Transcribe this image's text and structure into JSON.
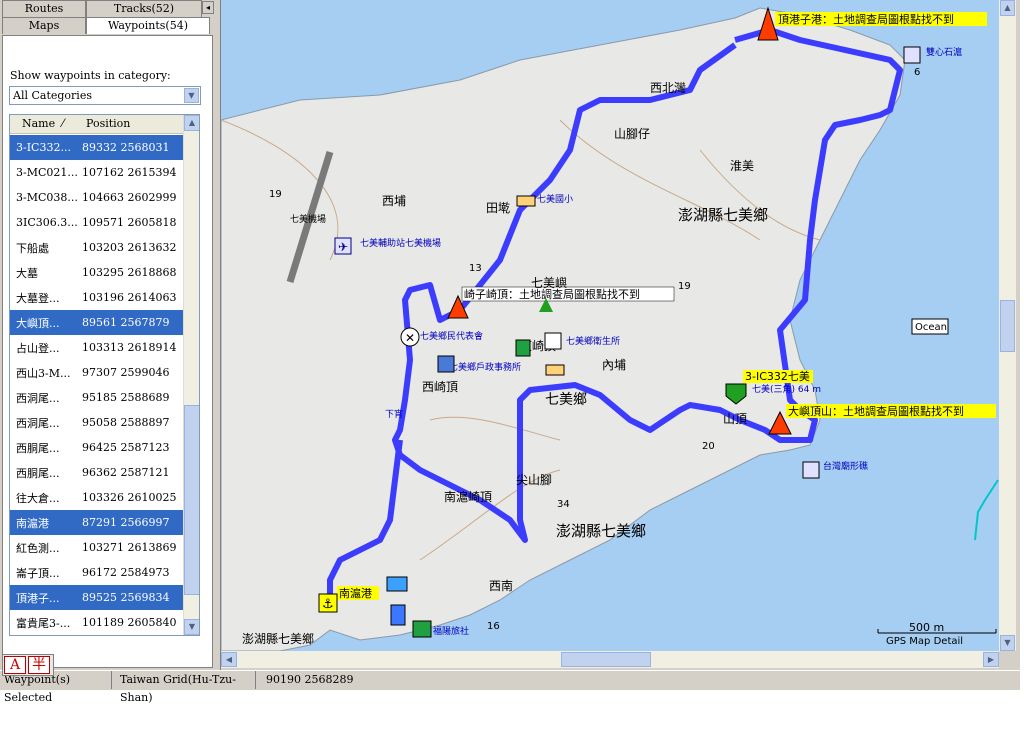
{
  "tabs": {
    "routes": "Routes",
    "tracks": "Tracks(52)",
    "maps": "Maps",
    "waypoints": "Waypoints(54)"
  },
  "collapse_glyph": "◂",
  "category": {
    "label": "Show waypoints in category:",
    "selected": "All Categories"
  },
  "list": {
    "col_name": "Name",
    "col_sort": "⁄",
    "col_position": "Position",
    "rows": [
      {
        "name": "3-IC332...",
        "position": "89332 2568031",
        "selected": true
      },
      {
        "name": "3-MC021...",
        "position": "107162 2615394",
        "selected": false
      },
      {
        "name": "3-MC038...",
        "position": "104663 2602999",
        "selected": false
      },
      {
        "name": "3IC306.3...",
        "position": "109571 2605818",
        "selected": false
      },
      {
        "name": "下船處",
        "position": "103203 2613632",
        "selected": false
      },
      {
        "name": "大墓",
        "position": "103295 2618868",
        "selected": false
      },
      {
        "name": "大墓登...",
        "position": "103196 2614063",
        "selected": false
      },
      {
        "name": "大嶼頂...",
        "position": "89561 2567879",
        "selected": true
      },
      {
        "name": "占山登...",
        "position": "103313 2618914",
        "selected": false
      },
      {
        "name": "西山3-M...",
        "position": "97307 2599046",
        "selected": false
      },
      {
        "name": "西洞尾...",
        "position": "95185 2588689",
        "selected": false
      },
      {
        "name": "西洞尾...",
        "position": "95058 2588897",
        "selected": false
      },
      {
        "name": "西胴尾...",
        "position": "96425 2587123",
        "selected": false
      },
      {
        "name": "西胴尾...",
        "position": "96362 2587121",
        "selected": false
      },
      {
        "name": "往大倉...",
        "position": "103326 2610025",
        "selected": false
      },
      {
        "name": "南滬港",
        "position": "87291 2566997",
        "selected": true
      },
      {
        "name": "紅色測...",
        "position": "103271 2613869",
        "selected": false
      },
      {
        "name": "崙子頂...",
        "position": "96172 2584973",
        "selected": false
      },
      {
        "name": "頂港子...",
        "position": "89525 2569834",
        "selected": true
      },
      {
        "name": "富貴尾3-...",
        "position": "101189 2605840",
        "selected": false
      }
    ]
  },
  "status": {
    "selection": "Waypoint(s) Selected",
    "grid": "Taiwan Grid(Hu-Tzu-Shan)",
    "coords": "90190 2568289"
  },
  "ime": {
    "a": "A",
    "b": "半"
  },
  "map": {
    "ocean_label": "Ocean",
    "scale_label": "500 m",
    "detail_label": "GPS Map Detail",
    "place_labels": [
      "西北灣",
      "山腳仔",
      "淮美",
      "澎湖縣七美鄉",
      "西埔",
      "田墘",
      "七美機場",
      "七美輔助站七美機場",
      "七美嶼",
      "七美鄉民代表會",
      "東崎頂",
      "七美鄉衛生所",
      "七美鄉戶政事務所",
      "內埔",
      "西崎頂",
      "七美鄉",
      "山頂",
      "下宵",
      "尖山腳",
      "南滬崎頂",
      "澎湖縣七美鄉",
      "西南",
      "澎湖縣七美鄉",
      "福陽旅社",
      "台灣廟形礁",
      "雙心石滬",
      "七美國小"
    ],
    "waypoint_labels": [
      "頂港子港：土地調查局圖根點找不到",
      "崎子崎頂：土地調查局圖根點找不到",
      "3-IC332七美",
      "大嶼頂山：土地調查局圖根點找不到",
      "南滬港"
    ],
    "number_labels": [
      "6",
      "19",
      "13",
      "19",
      "20",
      "34",
      "16"
    ],
    "elevation_label": "七美(三角) 64 m"
  },
  "colors": {
    "sea": "#a6cdf2",
    "land": "#e8e8e6",
    "track": "#3c3cff",
    "selection": "#316ac5",
    "label_bg": "#ffff00"
  }
}
